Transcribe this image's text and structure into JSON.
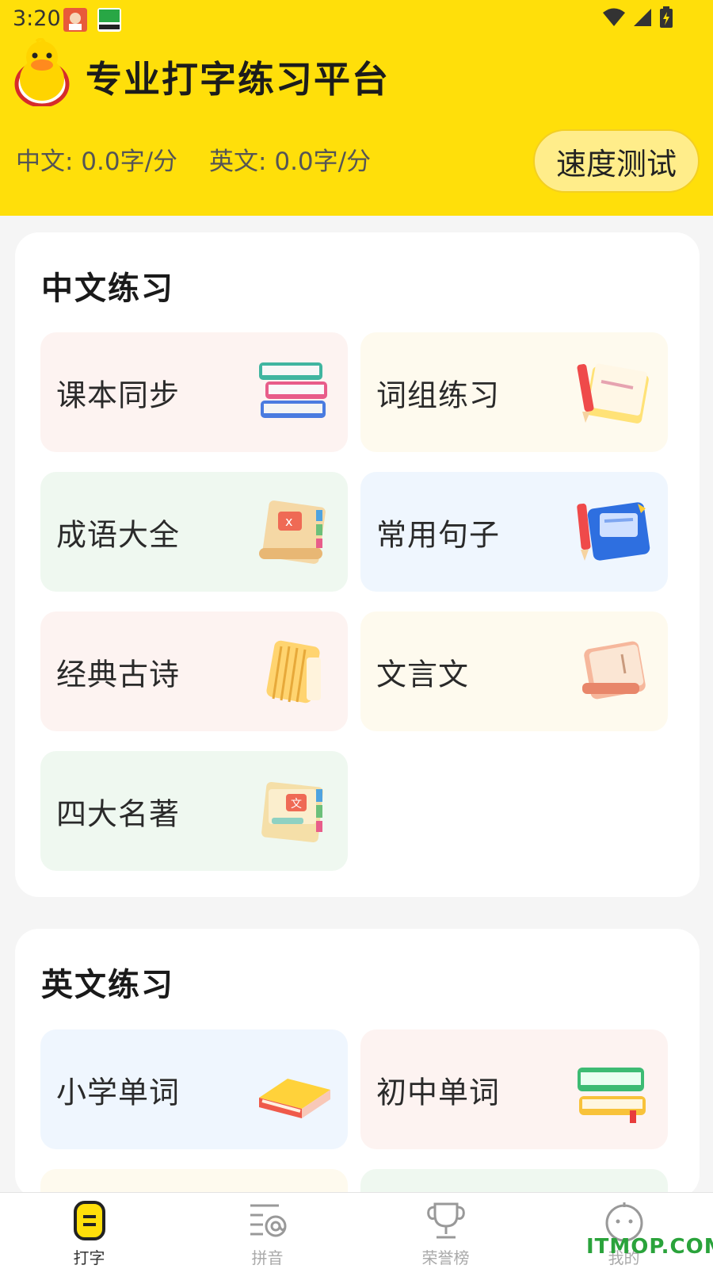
{
  "status_bar": {
    "time": "3:20"
  },
  "header": {
    "title": "专业打字练习平台",
    "chinese_speed": "中文: 0.0字/分",
    "english_speed": "英文: 0.0字/分",
    "speed_test_label": "速度测试",
    "accent_color": "#ffdf0a"
  },
  "chinese_section": {
    "title": "中文练习",
    "items": [
      {
        "label": "课本同步",
        "icon": "textbook-stack-icon"
      },
      {
        "label": "词组练习",
        "icon": "notebook-pencil-icon"
      },
      {
        "label": "成语大全",
        "icon": "scroll-icon"
      },
      {
        "label": "常用句子",
        "icon": "blue-notebook-icon"
      },
      {
        "label": "经典古诗",
        "icon": "bamboo-book-icon"
      },
      {
        "label": "文言文",
        "icon": "classic-book-icon"
      },
      {
        "label": "四大名著",
        "icon": "masterpiece-book-icon"
      }
    ]
  },
  "english_section": {
    "title": "英文练习",
    "items": [
      {
        "label": "小学单词",
        "icon": "yellow-book-icon"
      },
      {
        "label": "初中单词",
        "icon": "green-book-stack-icon"
      }
    ]
  },
  "bottom_nav": {
    "items": [
      {
        "label": "打字",
        "icon": "typing-icon",
        "active": true
      },
      {
        "label": "拼音",
        "icon": "pinyin-icon",
        "active": false
      },
      {
        "label": "荣誉榜",
        "icon": "trophy-icon",
        "active": false
      },
      {
        "label": "我的",
        "icon": "profile-face-icon",
        "active": false
      }
    ]
  },
  "watermark": "ITMOP.COM"
}
